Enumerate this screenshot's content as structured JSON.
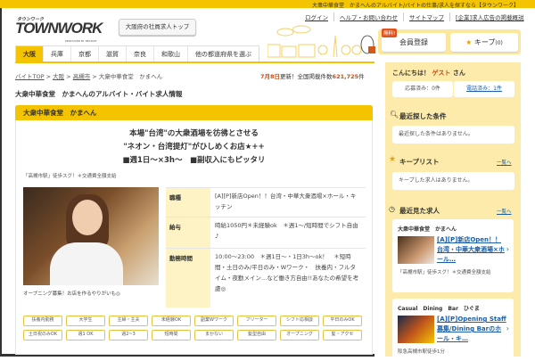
{
  "top_bar": "大衆中華食堂　かまへんのアルバイト/バイトの仕事/求人を探すなら【タウンワーク】",
  "logo": {
    "kana": "タウンワーク",
    "brand": "TOWNWORK",
    "by": "PRODUCED BY RECRUIT"
  },
  "header": {
    "top_button": "大阪府の社員求人トップ",
    "links": [
      "ログイン",
      "ヘルプ・お問い合わせ",
      "サイトマップ",
      "[企業]求人広告の掲載概説"
    ],
    "free_badge": "無料!",
    "register": "会員登録",
    "keep": "キープ",
    "keep_count": "(0)"
  },
  "tabs": [
    "大阪",
    "兵庫",
    "京都",
    "滋賀",
    "奈良",
    "和歌山",
    "他の都道府県を選ぶ"
  ],
  "breadcrumb": [
    "バイトTOP",
    "大阪",
    "高槻市",
    "大衆中華食堂　かまへん"
  ],
  "update": {
    "date": "7月8日",
    "mid": "更新！全国掲載件数",
    "count": "621,725",
    "unit": "件"
  },
  "page_title": "大衆中華食堂　かまへんのアルバイト・バイト求人情報",
  "job": {
    "name": "大衆中華食堂　かまへん",
    "catch": [
      "本場\"台湾\"の大衆酒場を彷彿とさせる",
      "\"ネオン・台湾提灯\"がひしめくお店★++",
      "■週1日～×3h～　■副収入にもピッタリ"
    ],
    "access": "「高槻市駅」徒歩スグ！＊交通費全額支給",
    "caption": "オープニング募集！お店を作るやりがいも◎",
    "rows": [
      {
        "label": "職種",
        "value": "[A][P]新店Open！！台湾・中華大衆酒場×ホール・キッチン"
      },
      {
        "label": "給与",
        "value": "時給1050円＊未経験ok　＊週1～/短時間でシフト自由♪"
      },
      {
        "label": "勤務時間",
        "value": "10:00～23:00　＊週1日～・1日3h～ok！　＊短時間・土日のみ/平日のみ・Wワーク・　扶養内・フルタイム・夜勤メイン…など働き方自由!!あなたの希望を考慮◎"
      }
    ],
    "tags": [
      "扶養内勤務",
      "大学生",
      "主婦・主夫",
      "未経験OK",
      "副業Wワーク",
      "フリーター",
      "シフト応相談",
      "平日のみOK",
      "土日祝のみOK",
      "週1 OK",
      "週2~3",
      "短時間",
      "まかない",
      "髪型自由",
      "オープニング",
      "髪・アクセ"
    ]
  },
  "sidebar": {
    "greeting": "こんにちは！",
    "guest": "ゲスト",
    "san": "さん",
    "applied": "応募済み：0件",
    "called": "電話済み：1件",
    "recent_search_title": "最近探した条件",
    "recent_search_empty": "最近探した条件はありません。",
    "keep_title": "キープリスト",
    "keep_more": "一覧へ",
    "keep_empty": "キープした求人はありません。",
    "viewed_title": "最近見た求人",
    "viewed_more": "一覧へ",
    "viewed": [
      {
        "name": "大衆中華食堂　かまへん",
        "title": "[A][P]新店Open！！台湾・中華大衆酒場×ホール…",
        "access": "「高槻市駅」徒歩スグ！＊交通費全額支給"
      },
      {
        "name": "Casual　Dining　Bar　ひぐま",
        "title": "[A][P]Opening Staff募集/Dining Barのホール・キ…",
        "access": "阪急高槻市駅徒歩1分"
      }
    ]
  },
  "colors": {
    "brand": "#f5c400",
    "sidebar": "#fcebaa",
    "link": "#1a5fa8",
    "accent": "#c0541c"
  }
}
